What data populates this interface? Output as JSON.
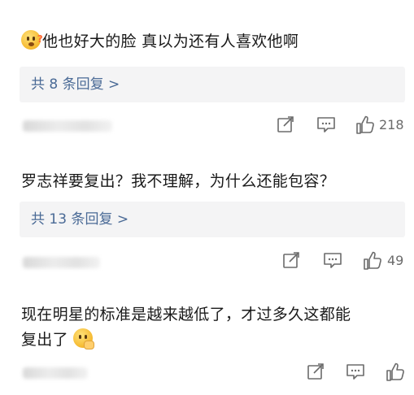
{
  "comments": [
    {
      "text": "他也好大的脸 真以为还有人喜欢他啊",
      "emoji": "thinking-face-icon",
      "reply_label": "共 8 条回复 >",
      "likes": "218"
    },
    {
      "text": "罗志祥要复出？我不理解，为什么还能包容？",
      "reply_label": "共 13 条回复 >",
      "likes": "49"
    },
    {
      "text_line1": "现在明星的标准是越来越低了，才过多久这都能",
      "text_line2": "复出了",
      "emoji": "shushing-face-icon",
      "likes": ""
    }
  ],
  "colors": {
    "reply_link": "#4a6a96",
    "reply_bg": "#f4f4f5",
    "icon_gray": "#6b6b6b"
  }
}
